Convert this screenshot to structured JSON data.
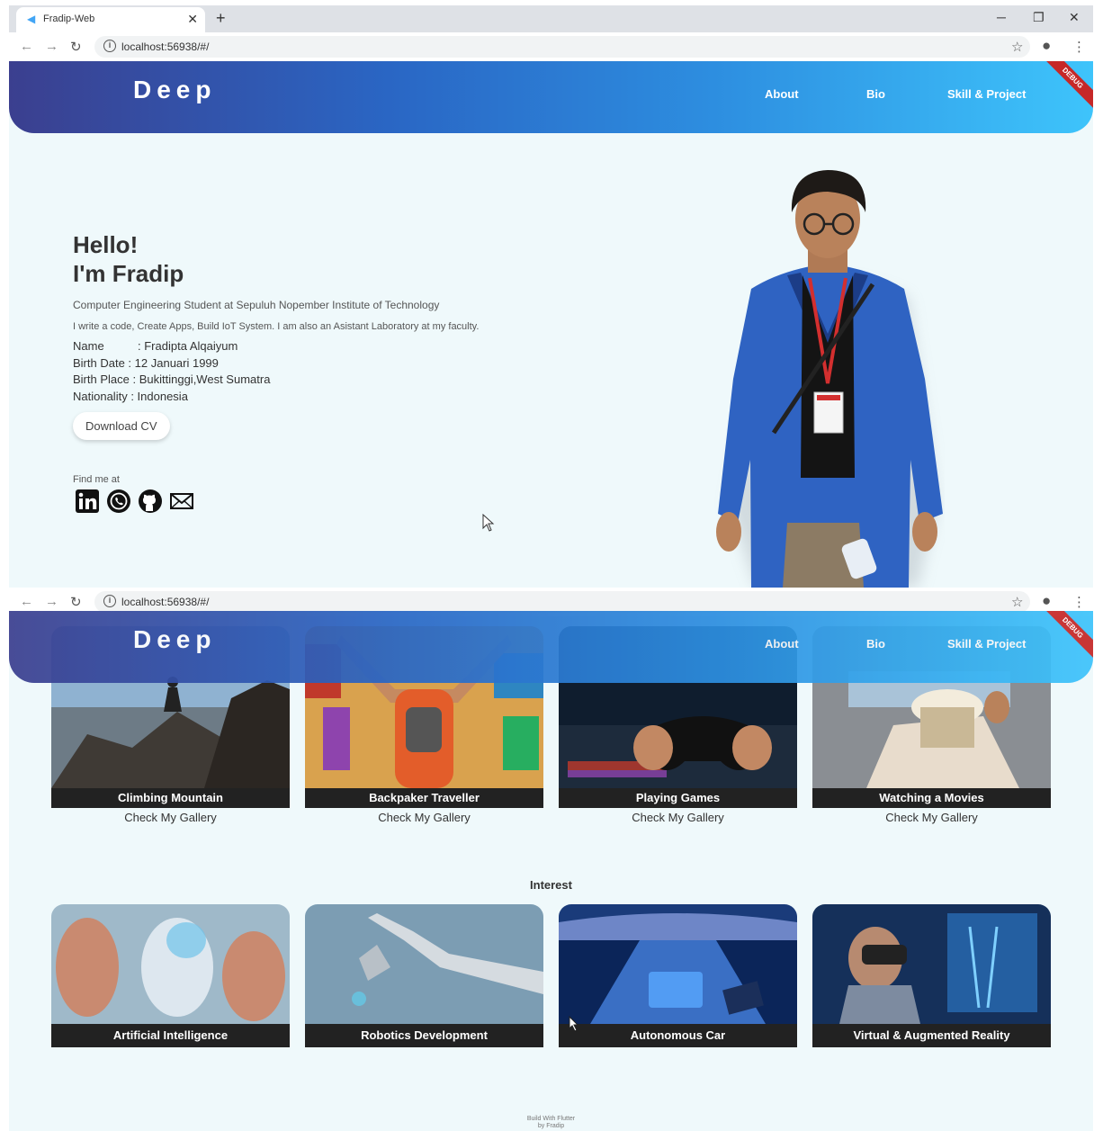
{
  "browser": {
    "tab_title": "Fradip-Web",
    "url": "localhost:56938/#/"
  },
  "header": {
    "logo": "Deep",
    "nav": [
      "About",
      "Bio",
      "Skill & Project"
    ],
    "debug_label": "DEBUG"
  },
  "hero": {
    "greeting_line1": "Hello!",
    "greeting_line2": "I'm Fradip",
    "subtitle": "Computer Engineering Student at Sepuluh Nopember Institute of Technology",
    "description": "I write a code, Create Apps, Build IoT System. I am also an Asistant Laboratory at my faculty.",
    "info": [
      {
        "label": "Name",
        "value": "Fradipta Alqaiyum"
      },
      {
        "label": "Birth Date",
        "value": "12 Januari 1999"
      },
      {
        "label": "Birth Place",
        "value": "Bukittinggi,West Sumatra"
      },
      {
        "label": "Nationality",
        "value": "Indonesia"
      }
    ],
    "download_button": "Download CV",
    "find_me": "Find me at",
    "socials": [
      "linkedin-icon",
      "whatsapp-icon",
      "github-icon",
      "mail-icon"
    ]
  },
  "hobbies": [
    {
      "title": "Climbing Mountain",
      "sub": "Check My Gallery"
    },
    {
      "title": "Backpaker Traveller",
      "sub": "Check My Gallery"
    },
    {
      "title": "Playing Games",
      "sub": "Check My Gallery"
    },
    {
      "title": "Watching a Movies",
      "sub": "Check My Gallery"
    }
  ],
  "interest": {
    "title": "Interest",
    "items": [
      "Artificial Intelligence",
      "Robotics Development",
      "Autonomous Car",
      "Virtual & Augmented Reality"
    ]
  },
  "footer": {
    "line1": "Build With Flutter",
    "line2": "by Fradip"
  },
  "colors": {
    "header_start": "#3b3f8f",
    "header_end": "#3ec4fb",
    "page_bg": "#eff9fb",
    "caption_bg": "#222222"
  }
}
